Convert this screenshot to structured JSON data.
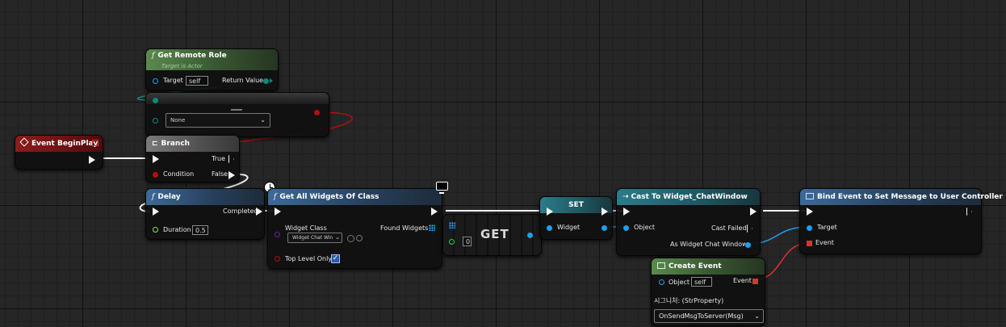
{
  "colors": {
    "exec": "#f2f2f2",
    "object_pin": "#1f9df0",
    "bool_pin": "#b80d0d",
    "enum_pin": "#0c8a7a",
    "class_pin": "#6b1fa8",
    "int_pin": "#2fd34b",
    "float_pin": "#8be05c",
    "event_pin": "#e03030"
  },
  "nodes": {
    "get_remote_role": {
      "title": "Get Remote Role",
      "subtitle": "Target is Actor",
      "icon": "function-icon",
      "target_label": "Target",
      "target_value": "self",
      "return_label": "Return Value"
    },
    "select_enum": {
      "icon": "select-icon",
      "option_value": "None"
    },
    "event_begin_play": {
      "title": "Event BeginPlay",
      "icon": "event-icon"
    },
    "branch": {
      "title": "Branch",
      "icon": "branch-icon",
      "condition_label": "Condition",
      "true_label": "True",
      "false_label": "False"
    },
    "delay": {
      "title": "Delay",
      "icon": "function-icon",
      "completed_label": "Completed",
      "duration_label": "Duration",
      "duration_value": "0.5"
    },
    "get_all_widgets": {
      "title": "Get All Widgets Of Class",
      "icon": "function-icon",
      "widget_class_label": "Widget Class",
      "widget_class_value": "Widget Chat Win",
      "found_widgets_label": "Found Widgets",
      "top_level_only_label": "Top Level Only",
      "top_level_only_checked": true,
      "checkmark": "✓"
    },
    "get_array": {
      "title": "GET",
      "index_value": "0"
    },
    "set_var": {
      "title": "SET",
      "widget_label": "Widget"
    },
    "cast_to": {
      "title": "Cast To Widget_ChatWindow",
      "icon": "cast-icon",
      "object_label": "Object",
      "cast_failed_label": "Cast Failed",
      "as_label": "As Widget Chat Window"
    },
    "bind_event": {
      "title": "Bind Event to Set Message to User Controller",
      "icon": "bind-icon",
      "target_label": "Target",
      "event_label": "Event"
    },
    "create_event": {
      "title": "Create Event",
      "icon": "create-event-icon",
      "object_label": "Object",
      "object_value": "self",
      "event_label": "Event",
      "signature_text": "시그니처: (StrProperty)",
      "function_value": "OnSendMsgToServer(Msg)"
    }
  }
}
